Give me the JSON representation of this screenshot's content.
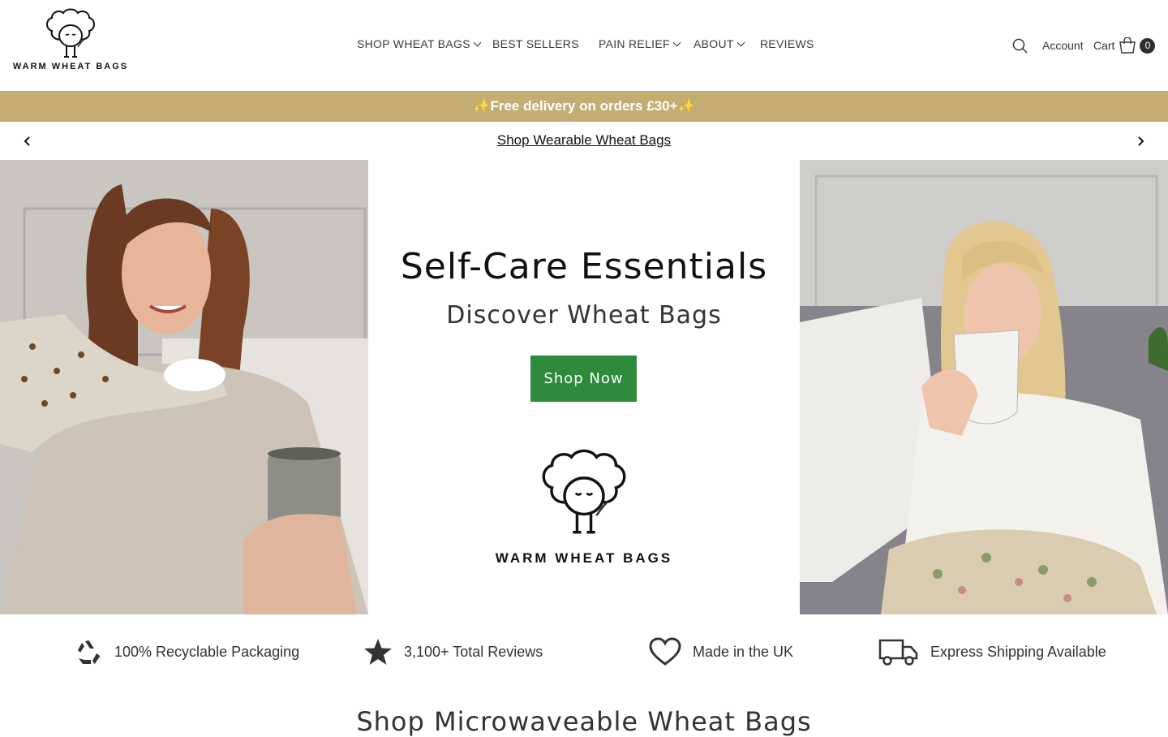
{
  "header": {
    "logo_text": "WARM WHEAT BAGS",
    "nav": [
      {
        "label": "SHOP WHEAT BAGS",
        "has_dropdown": true
      },
      {
        "label": "BEST SELLERS",
        "has_dropdown": false
      },
      {
        "label": "PAIN RELIEF",
        "has_dropdown": true
      },
      {
        "label": "ABOUT",
        "has_dropdown": true
      },
      {
        "label": "REVIEWS",
        "has_dropdown": false
      }
    ],
    "account_label": "Account",
    "cart_label": "Cart",
    "cart_count": "0"
  },
  "promo_bar": {
    "text": "✨Free delivery on orders £30+✨",
    "background": "#c4ad72"
  },
  "announcement": {
    "link_text": "Shop Wearable Wheat Bags"
  },
  "hero": {
    "title": "Self-Care Essentials",
    "subtitle": "Discover Wheat Bags",
    "cta_label": "Shop Now",
    "cta_color": "#2e8b3c",
    "logo_text": "WARM WHEAT BAGS"
  },
  "features": [
    {
      "icon": "recycle-icon",
      "text": "100% Recyclable Packaging"
    },
    {
      "icon": "star-icon",
      "text": "3,100+ Total Reviews"
    },
    {
      "icon": "heart-icon",
      "text": "Made in the UK"
    },
    {
      "icon": "truck-icon",
      "text": "Express Shipping Available"
    }
  ],
  "section": {
    "title": "Shop Microwaveable Wheat Bags"
  }
}
